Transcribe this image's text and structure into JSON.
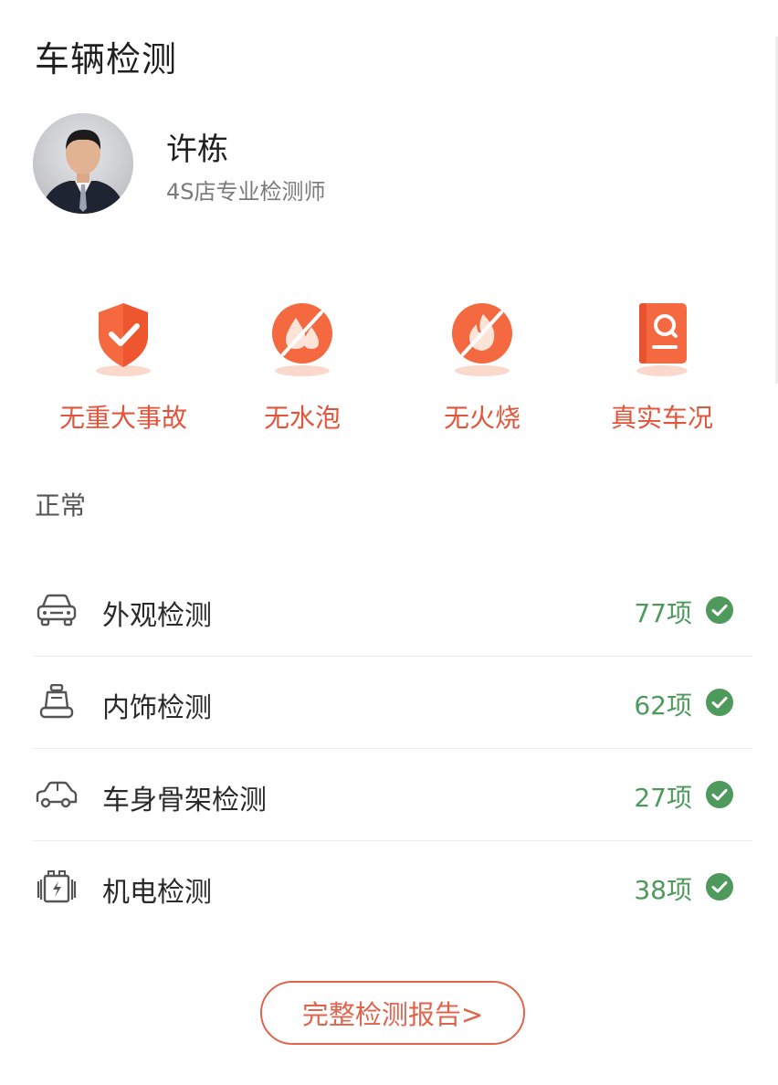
{
  "page": {
    "title": "车辆检测"
  },
  "inspector": {
    "name": "许栋",
    "title": "4S店专业检测师"
  },
  "badges": [
    {
      "label": "无重大事故",
      "icon": "shield-check-icon"
    },
    {
      "label": "无水泡",
      "icon": "no-water-icon"
    },
    {
      "label": "无火烧",
      "icon": "no-fire-icon"
    },
    {
      "label": "真实车况",
      "icon": "report-search-icon"
    }
  ],
  "section": {
    "title": "正常"
  },
  "checks": [
    {
      "label": "外观检测",
      "count": "77项",
      "icon": "car-front-icon",
      "status": "passed"
    },
    {
      "label": "内饰检测",
      "count": "62项",
      "icon": "car-seat-icon",
      "status": "passed"
    },
    {
      "label": "车身骨架检测",
      "count": "27项",
      "icon": "car-side-icon",
      "status": "passed"
    },
    {
      "label": "机电检测",
      "count": "38项",
      "icon": "battery-icon",
      "status": "passed"
    }
  ],
  "report_button": {
    "label": "完整检测报告>"
  },
  "colors": {
    "accent": "#e4543a",
    "badge_orange": "#f4693f",
    "success": "#4e9a5c"
  }
}
